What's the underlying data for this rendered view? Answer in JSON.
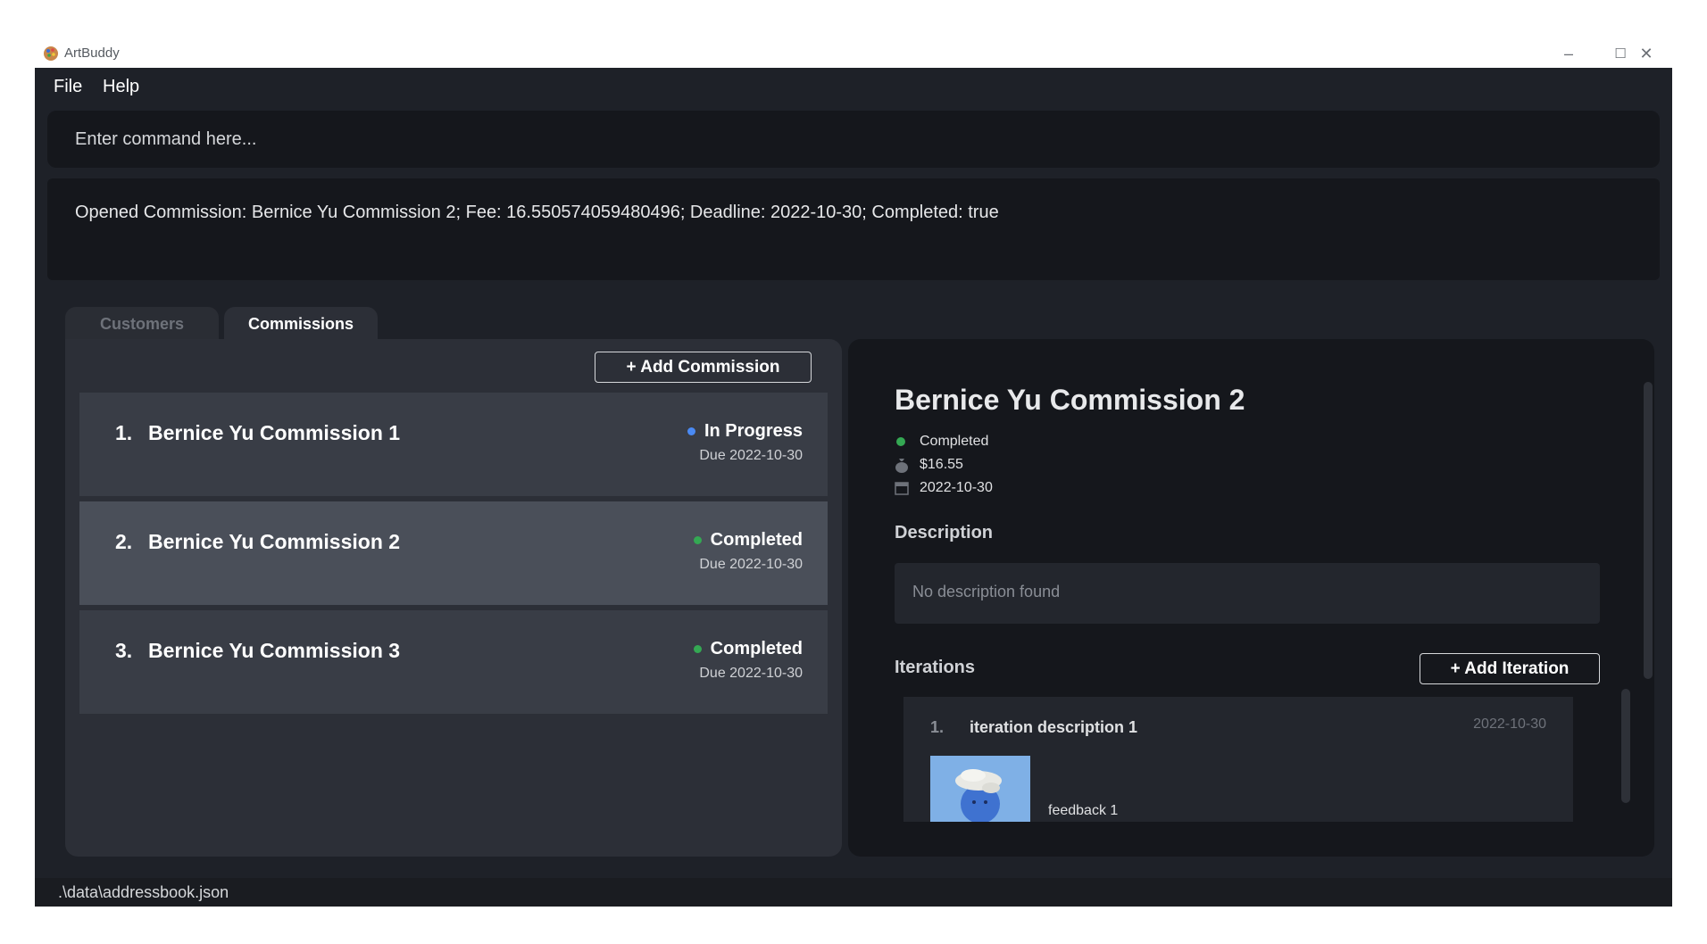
{
  "window": {
    "title": "ArtBuddy",
    "controls": {
      "minimize": "–",
      "maximize": "☐",
      "close": "✕"
    }
  },
  "menu": {
    "file": "File",
    "help": "Help"
  },
  "command": {
    "placeholder": "Enter command here...",
    "value": ""
  },
  "result": {
    "text": "Opened Commission: Bernice Yu Commission 2; Fee: 16.550574059480496; Deadline: 2022-10-30; Completed: true"
  },
  "tabs": [
    {
      "label": "Customers",
      "active": false
    },
    {
      "label": "Commissions",
      "active": true
    }
  ],
  "commissions": {
    "add_button": "+  Add Commission",
    "items": [
      {
        "index": "1.",
        "name": "Bernice Yu Commission 1",
        "status": "In Progress",
        "status_color": "#4a8af4",
        "due": "Due 2022-10-30",
        "selected": false
      },
      {
        "index": "2.",
        "name": "Bernice Yu Commission 2",
        "status": "Completed",
        "status_color": "#34a853",
        "due": "Due 2022-10-30",
        "selected": true
      },
      {
        "index": "3.",
        "name": "Bernice Yu Commission 3",
        "status": "Completed",
        "status_color": "#34a853",
        "due": "Due 2022-10-30",
        "selected": false
      }
    ]
  },
  "detail": {
    "title": "Bernice Yu Commission 2",
    "status": "Completed",
    "status_color": "#34a853",
    "fee": "$16.55",
    "fee_icon": "money-bag-icon",
    "deadline": "2022-10-30",
    "deadline_icon": "calendar-icon",
    "description_heading": "Description",
    "description": "No description found",
    "iterations_heading": "Iterations",
    "add_iteration_button": "+  Add Iteration",
    "iterations": [
      {
        "index": "1.",
        "description": "iteration description 1",
        "date": "2022-10-30",
        "feedback": "feedback 1",
        "image": "blob-character-image"
      }
    ]
  },
  "statusbar": {
    "path": ".\\data\\addressbook.json"
  }
}
